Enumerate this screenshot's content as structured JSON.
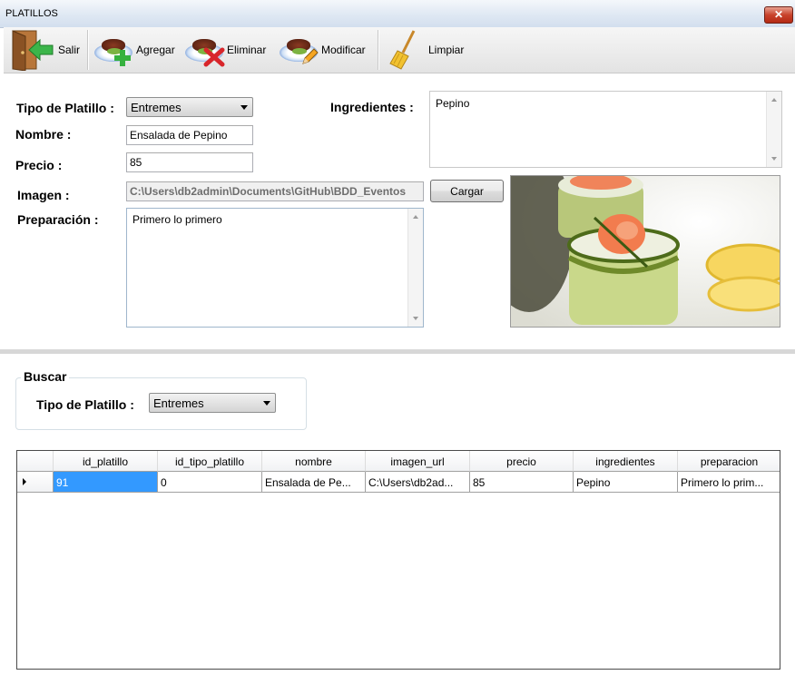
{
  "window": {
    "title": "PLATILLOS",
    "close_glyph": "✕"
  },
  "toolbar": {
    "salir": "Salir",
    "agregar": "Agregar",
    "eliminar": "Eliminar",
    "modificar": "Modificar",
    "limpiar": "Limpiar"
  },
  "form": {
    "tipo_label": "Tipo de Platillo :",
    "tipo_value": "Entremes",
    "nombre_label": "Nombre :",
    "nombre_value": "Ensalada de Pepino",
    "precio_label": "Precio :",
    "precio_value": "85",
    "imagen_label": "Imagen :",
    "imagen_value": "C:\\Users\\db2admin\\Documents\\GitHub\\BDD_Eventos",
    "cargar_button": "Cargar",
    "preparacion_label": "Preparación :",
    "preparacion_value": "Primero lo primero",
    "ingredientes_label": "Ingredientes :",
    "ingredientes_value": "Pepino"
  },
  "search": {
    "group_title": "Buscar",
    "tipo_label": "Tipo de Platillo :",
    "tipo_value": "Entremes"
  },
  "grid": {
    "columns": [
      "id_platillo",
      "id_tipo_platillo",
      "nombre",
      "imagen_url",
      "precio",
      "ingredientes",
      "preparacion"
    ],
    "rows": [
      [
        "91",
        "0",
        "Ensalada de Pe...",
        "C:\\Users\\db2ad...",
        "85",
        "Pepino",
        "Primero lo prim..."
      ]
    ]
  },
  "colors": {
    "selection": "#3399ff",
    "close_button": "#c8432c"
  },
  "icons": [
    "exit-door-icon",
    "add-dish-icon",
    "delete-dish-icon",
    "edit-dish-icon",
    "broom-icon",
    "dish-photo"
  ]
}
